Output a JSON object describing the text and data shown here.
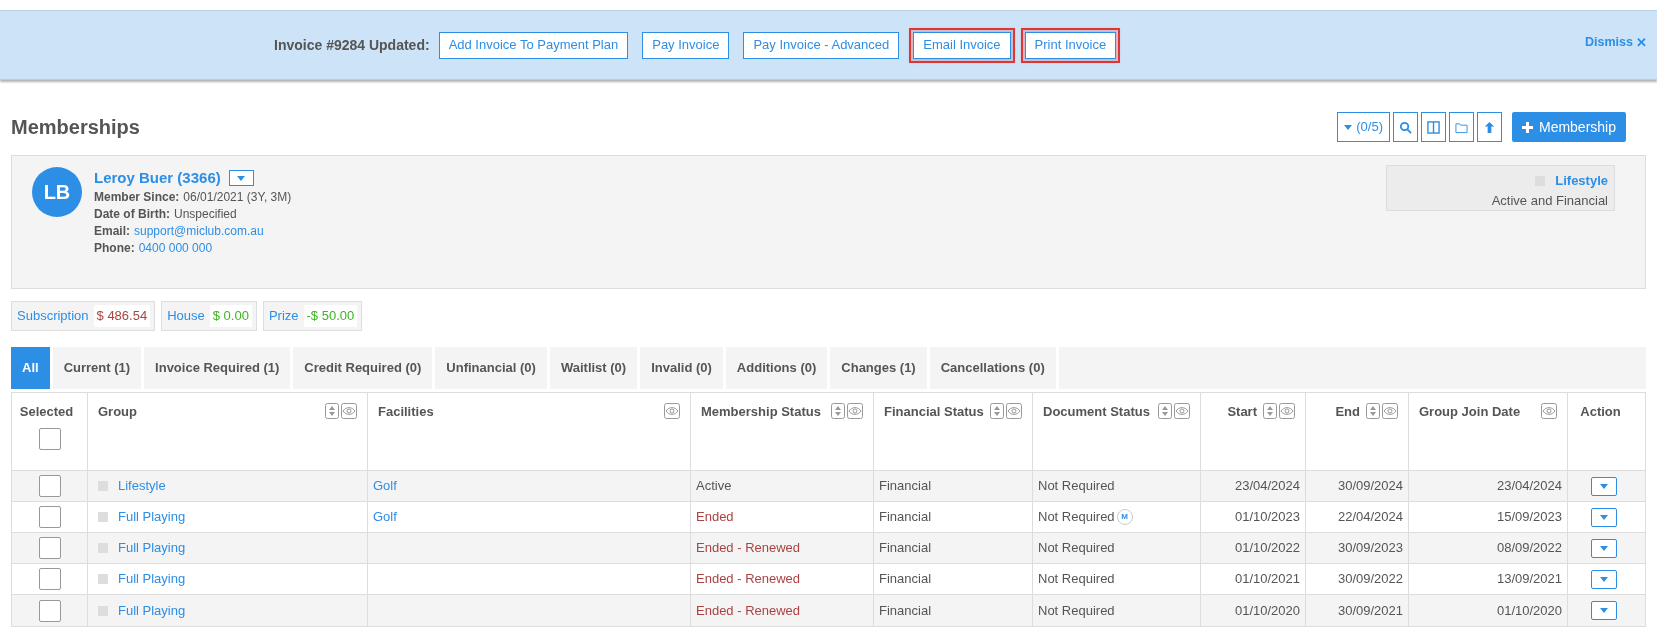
{
  "banner": {
    "title": "Invoice #9284 Updated:",
    "buttons": [
      {
        "label": "Add Invoice To Payment Plan",
        "highlighted": false
      },
      {
        "label": "Pay Invoice",
        "highlighted": false
      },
      {
        "label": "Pay Invoice - Advanced",
        "highlighted": false
      },
      {
        "label": "Email Invoice",
        "highlighted": true
      },
      {
        "label": "Print Invoice",
        "highlighted": true
      }
    ],
    "dismiss": "Dismiss",
    "dismiss_icon": "✕"
  },
  "page_title": "Memberships",
  "toolbar": {
    "filter_count": "(0/5)",
    "add_button": "Membership"
  },
  "member": {
    "initials": "LB",
    "name": "Leroy Buer (3366)",
    "details": [
      {
        "label": "Member Since:",
        "value": "06/01/2021 (3Y, 3M)",
        "kind": "text"
      },
      {
        "label": "Date of Birth:",
        "value": "Unspecified",
        "kind": "text"
      },
      {
        "label": "Email:",
        "value": "support@miclub.com.au",
        "kind": "link"
      },
      {
        "label": "Phone:",
        "value": "0400 000 000",
        "kind": "link"
      }
    ],
    "current_group": {
      "name": "Lifestyle",
      "status": "Active and Financial"
    }
  },
  "balances": [
    {
      "label": "Subscription",
      "amount": "$ 486.54",
      "kind": "debit"
    },
    {
      "label": "House",
      "amount": "$ 0.00",
      "kind": "credit"
    },
    {
      "label": "Prize",
      "amount": "-$ 50.00",
      "kind": "credit"
    }
  ],
  "tabs": [
    {
      "label": "All",
      "selected": true
    },
    {
      "label": "Current (1)",
      "selected": false
    },
    {
      "label": "Invoice Required (1)",
      "selected": false
    },
    {
      "label": "Credit Required (0)",
      "selected": false
    },
    {
      "label": "Unfinancial (0)",
      "selected": false
    },
    {
      "label": "Waitlist (0)",
      "selected": false
    },
    {
      "label": "Invalid (0)",
      "selected": false
    },
    {
      "label": "Additions (0)",
      "selected": false
    },
    {
      "label": "Changes (1)",
      "selected": false
    },
    {
      "label": "Cancellations (0)",
      "selected": false
    }
  ],
  "table": {
    "select_all_checked": false,
    "columns": [
      {
        "label": "Selected",
        "sortable": false,
        "toggle": false
      },
      {
        "label": "Group",
        "sortable": true,
        "toggle": true
      },
      {
        "label": "Facilities",
        "sortable": false,
        "toggle": true
      },
      {
        "label": "Membership Status",
        "sortable": true,
        "toggle": true
      },
      {
        "label": "Financial Status",
        "sortable": true,
        "toggle": true
      },
      {
        "label": "Document Status",
        "sortable": true,
        "toggle": true
      },
      {
        "label": "Start",
        "sortable": true,
        "toggle": true
      },
      {
        "label": "End",
        "sortable": true,
        "toggle": true
      },
      {
        "label": "Group Join Date",
        "sortable": false,
        "toggle": true
      },
      {
        "label": "Action",
        "sortable": false,
        "toggle": false
      }
    ],
    "rows": [
      {
        "checked": false,
        "group": "Lifestyle",
        "facilities": "Golf",
        "membership_status": "Active",
        "kind": "active",
        "financial_status": "Financial",
        "document_status": "Not Required",
        "start": "23/04/2024",
        "end": "30/09/2024",
        "group_join_date": "23/04/2024"
      },
      {
        "checked": false,
        "group": "Full Playing",
        "facilities": "Golf",
        "membership_status": "Ended",
        "kind": "ended",
        "financial_status": "Financial",
        "document_status": "Not Required",
        "document_badge": "M",
        "start": "01/10/2023",
        "end": "22/04/2024",
        "group_join_date": "15/09/2023"
      },
      {
        "checked": false,
        "group": "Full Playing",
        "membership_status": "Ended - Renewed",
        "kind": "ended",
        "financial_status": "Financial",
        "document_status": "Not Required",
        "start": "01/10/2022",
        "end": "30/09/2023",
        "group_join_date": "08/09/2022"
      },
      {
        "checked": false,
        "group": "Full Playing",
        "membership_status": "Ended - Renewed",
        "kind": "ended",
        "financial_status": "Financial",
        "document_status": "Not Required",
        "start": "01/10/2021",
        "end": "30/09/2022",
        "group_join_date": "13/09/2021"
      },
      {
        "checked": false,
        "group": "Full Playing",
        "membership_status": "Ended - Renewed",
        "kind": "ended",
        "financial_status": "Financial",
        "document_status": "Not Required",
        "start": "01/10/2020",
        "end": "30/09/2021",
        "group_join_date": "01/10/2020"
      }
    ]
  }
}
